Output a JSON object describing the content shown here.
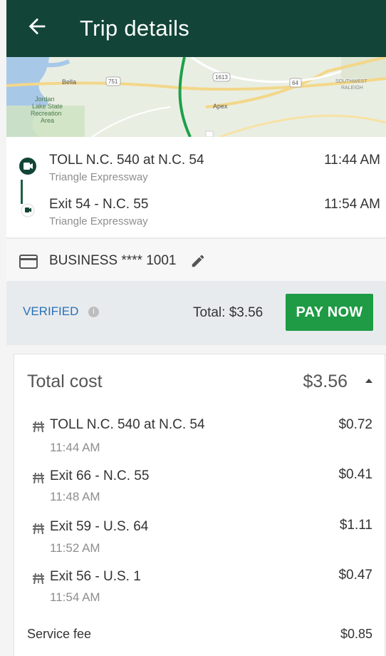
{
  "appbar": {
    "title": "Trip details"
  },
  "map": {
    "labels": [
      "Bella",
      "751",
      "Jordan Lake State Recreation Area",
      "1613",
      "64",
      "Apex",
      "SOUTHWEST RALEIGH"
    ]
  },
  "route": {
    "start": {
      "name": "TOLL N.C. 540 at N.C. 54",
      "road": "Triangle Expressway",
      "time": "11:44 AM"
    },
    "end": {
      "name": "Exit 54 - N.C. 55",
      "road": "Triangle Expressway",
      "time": "11:54 AM"
    }
  },
  "payment": {
    "method": "BUSINESS **** 1001"
  },
  "paybar": {
    "status": "VERIFIED",
    "info_glyph": "i",
    "total": "Total: $3.56",
    "pay_label": "PAY NOW"
  },
  "cost": {
    "title": "Total cost",
    "total": "$3.56",
    "items": [
      {
        "name": "TOLL N.C. 540 at N.C. 54",
        "time": "11:44 AM",
        "amount": "$0.72"
      },
      {
        "name": "Exit 66 - N.C. 55",
        "time": "11:48 AM",
        "amount": "$0.41"
      },
      {
        "name": "Exit 59 - U.S. 64",
        "time": "11:52 AM",
        "amount": "$1.11"
      },
      {
        "name": "Exit 56 - U.S. 1",
        "time": "11:54 AM",
        "amount": "$0.47"
      }
    ],
    "fee_label": "Service fee",
    "fee_amount": "$0.85"
  },
  "colors": {
    "appbar": "#124537",
    "pay_button": "#1e9b44",
    "verified": "#2970b4",
    "route_green": "#1a6140"
  },
  "icons": [
    "back-arrow-icon",
    "start-marker-icon",
    "end-marker-icon",
    "card-icon",
    "pencil-icon",
    "info-icon",
    "caret-up-icon",
    "toll-road-icon"
  ]
}
